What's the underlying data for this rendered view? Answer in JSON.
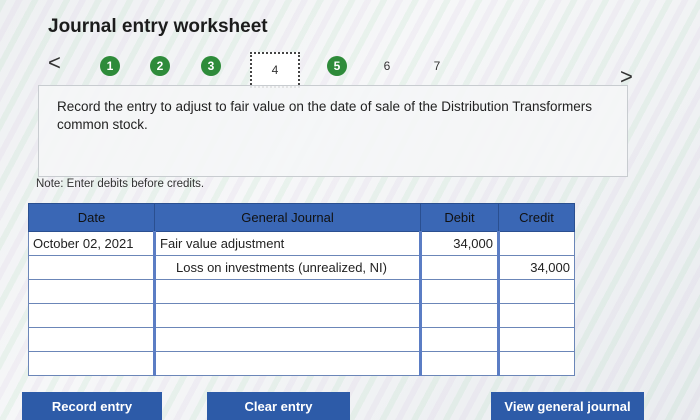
{
  "page": {
    "title": "Journal entry worksheet"
  },
  "nav": {
    "prev": "<",
    "next": ">",
    "steps": [
      {
        "label": "1",
        "state": "done"
      },
      {
        "label": "2",
        "state": "done"
      },
      {
        "label": "3",
        "state": "done"
      },
      {
        "label": "4",
        "state": "active"
      },
      {
        "label": "5",
        "state": "done"
      },
      {
        "label": "6",
        "state": "plain"
      },
      {
        "label": "7",
        "state": "plain"
      }
    ]
  },
  "instruction": {
    "text": "Record the entry to adjust to fair value on the date of sale of the Distribution Transformers common stock."
  },
  "note": "Note: Enter debits before credits.",
  "table": {
    "headers": {
      "date": "Date",
      "general_journal": "General Journal",
      "debit": "Debit",
      "credit": "Credit"
    },
    "rows": [
      {
        "date": "October 02, 2021",
        "account": "Fair value adjustment",
        "debit": "34,000",
        "credit": ""
      },
      {
        "date": "",
        "account": "Loss on investments (unrealized, NI)",
        "debit": "",
        "credit": "34,000"
      },
      {
        "date": "",
        "account": "",
        "debit": "",
        "credit": ""
      },
      {
        "date": "",
        "account": "",
        "debit": "",
        "credit": ""
      },
      {
        "date": "",
        "account": "",
        "debit": "",
        "credit": ""
      },
      {
        "date": "",
        "account": "",
        "debit": "",
        "credit": ""
      }
    ]
  },
  "buttons": {
    "record": "Record entry",
    "clear": "Clear entry",
    "view": "View general journal"
  },
  "colors": {
    "step_done": "#2e8b3a",
    "header_bg": "#3a67b5",
    "button_bg": "#2d5ba8"
  }
}
